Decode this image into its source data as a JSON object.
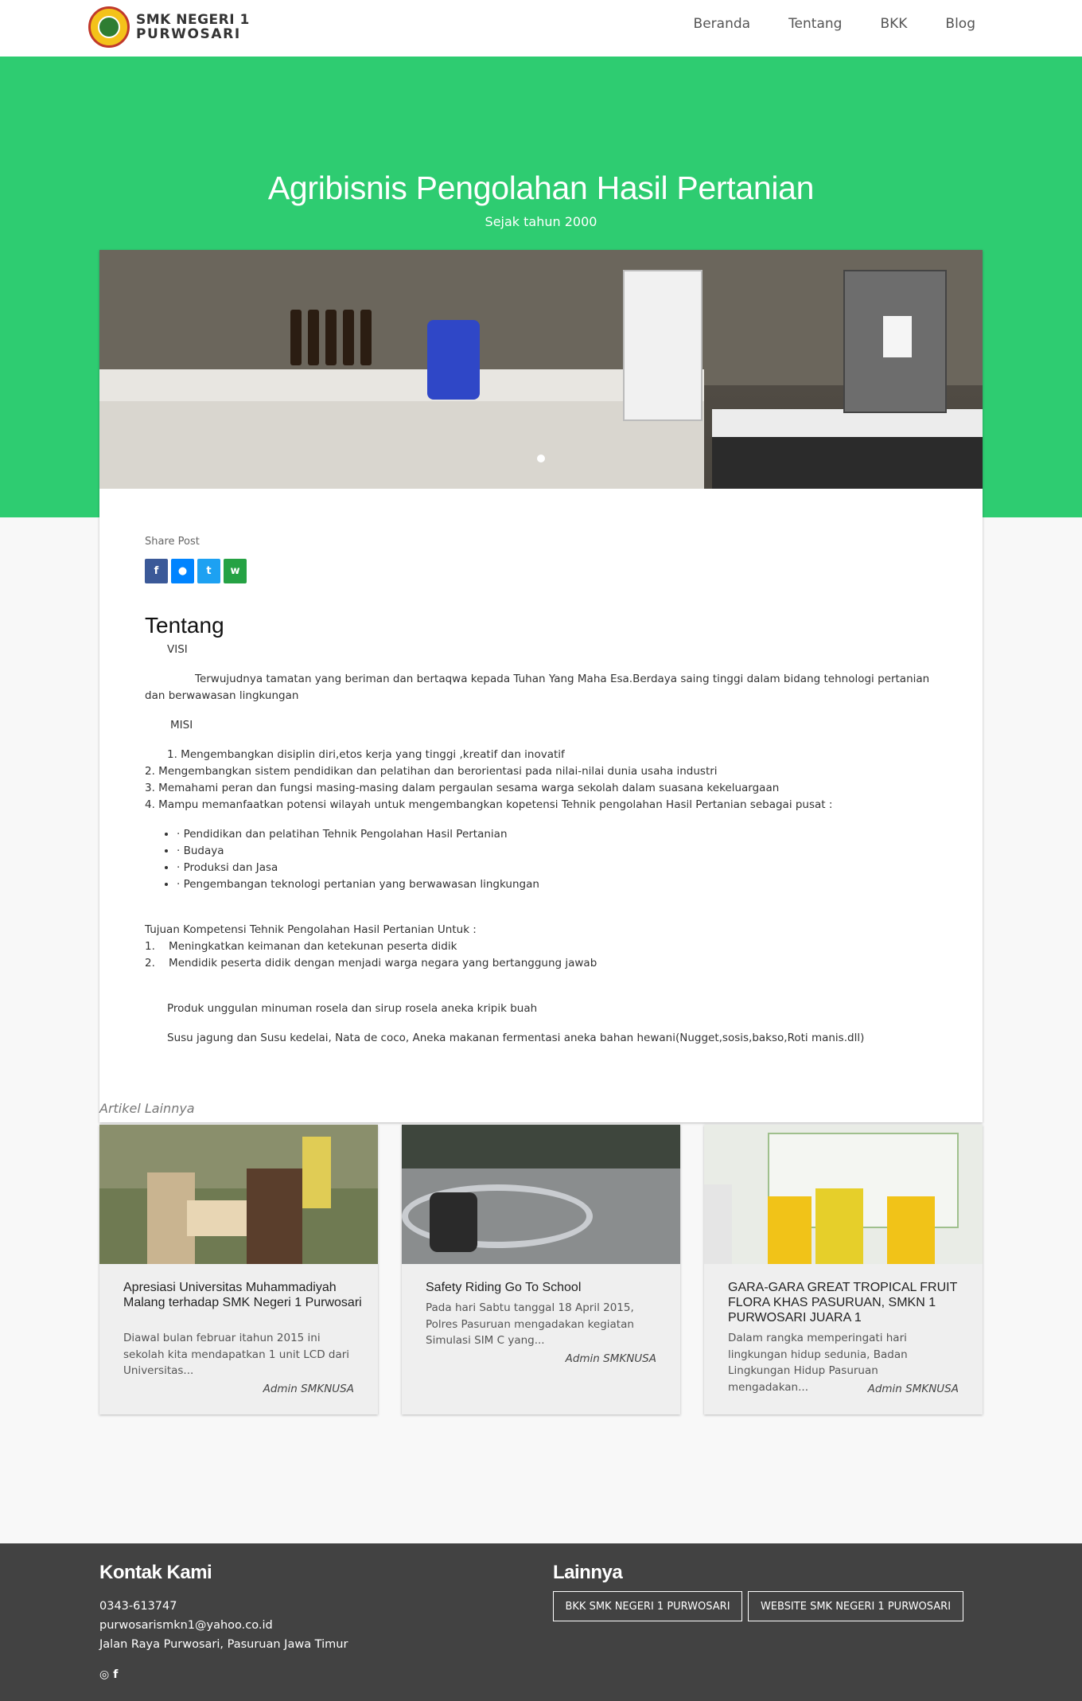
{
  "brand": {
    "line1": "SMK NEGERI 1",
    "line2": "PURWOSARI"
  },
  "nav": [
    "Beranda",
    "Tentang",
    "BKK",
    "Blog"
  ],
  "hero": {
    "title": "Agribisnis Pengolahan Hasil Pertanian",
    "subtitle": "Sejak tahun 2000"
  },
  "share": {
    "label": "Share Post",
    "fb": "f",
    "msg": "●",
    "tw": "t",
    "wa": "w"
  },
  "content": {
    "heading": "Tentang",
    "visi_label": "VISI",
    "visi_text": "Terwujudnya tamatan yang beriman dan bertaqwa kepada Tuhan Yang Maha Esa.Berdaya saing tinggi dalam bidang tehnologi pertanian dan berwawasan lingkungan",
    "misi_label": "MISI",
    "misi": [
      "1. Mengembangkan disiplin diri,etos kerja yang tinggi ,kreatif dan inovatif",
      "2. Mengembangkan sistem pendidikan dan pelatihan dan berorientasi pada nilai-nilai dunia usaha industri",
      "3. Memahami peran dan fungsi masing-masing dalam pergaulan sesama warga sekolah dalam suasana kekeluargaan",
      "4. Mampu memanfaatkan potensi wilayah untuk mengembangkan kopetensi Tehnik pengolahan Hasil Pertanian sebagai pusat :"
    ],
    "bullets": [
      "· Pendidikan dan pelatihan Tehnik Pengolahan Hasil Pertanian",
      "· Budaya",
      "· Produksi dan Jasa",
      "· Pengembangan teknologi pertanian yang berwawasan lingkungan"
    ],
    "tujuan_title": "Tujuan Kompetensi Tehnik Pengolahan Hasil Pertanian Untuk :",
    "tujuan": [
      "1.    Meningkatkan keimanan dan ketekunan peserta didik",
      "2.    Mendidik peserta didik dengan menjadi warga negara yang bertanggung jawab"
    ],
    "produk1": "Produk unggulan minuman rosela dan sirup rosela aneka kripik buah",
    "produk2": "Susu jagung dan Susu kedelai, Nata de coco, Aneka makanan fermentasi aneka bahan hewani(Nugget,sosis,bakso,Roti manis.dll)"
  },
  "related": {
    "title": "Artikel Lainnya",
    "items": [
      {
        "title": "Apresiasi Universitas Muhammadiyah Malang terhadap SMK Negeri 1 Purwosari",
        "desc": "Diawal bulan februar itahun 2015  ini sekolah kita mendapatkan 1 unit LCD dari Universitas...",
        "author": "Admin SMKNUSA"
      },
      {
        "title": "Safety Riding Go To School",
        "desc": "Pada hari Sabtu tanggal 18 April 2015, Polres Pasuruan mengadakan kegiatan Simulasi SIM C yang...",
        "author": "Admin SMKNUSA"
      },
      {
        "title": "GARA-GARA GREAT TROPICAL FRUIT FLORA KHAS PASURUAN, SMKN 1 PURWOSARI JUARA 1",
        "desc": "Dalam rangka memperingati hari lingkungan hidup sedunia, Badan Lingkungan Hidup Pasuruan mengadakan...",
        "author": "Admin SMKNUSA"
      }
    ]
  },
  "footer": {
    "contact_title": "Kontak Kami",
    "phone": "0343-613747",
    "email": "purwosarismkn1@yahoo.co.id",
    "address": "Jalan Raya Purwosari, Pasuruan Jawa Timur",
    "other_title": "Lainnya",
    "btn1": "BKK SMK NEGERI 1 PURWOSARI",
    "btn2": "WEBSITE SMK NEGERI 1 PURWOSARI",
    "social_ig": "◎",
    "social_fb": "f"
  },
  "colors": {
    "hero": "#2ecc71",
    "footer": "#424242"
  }
}
